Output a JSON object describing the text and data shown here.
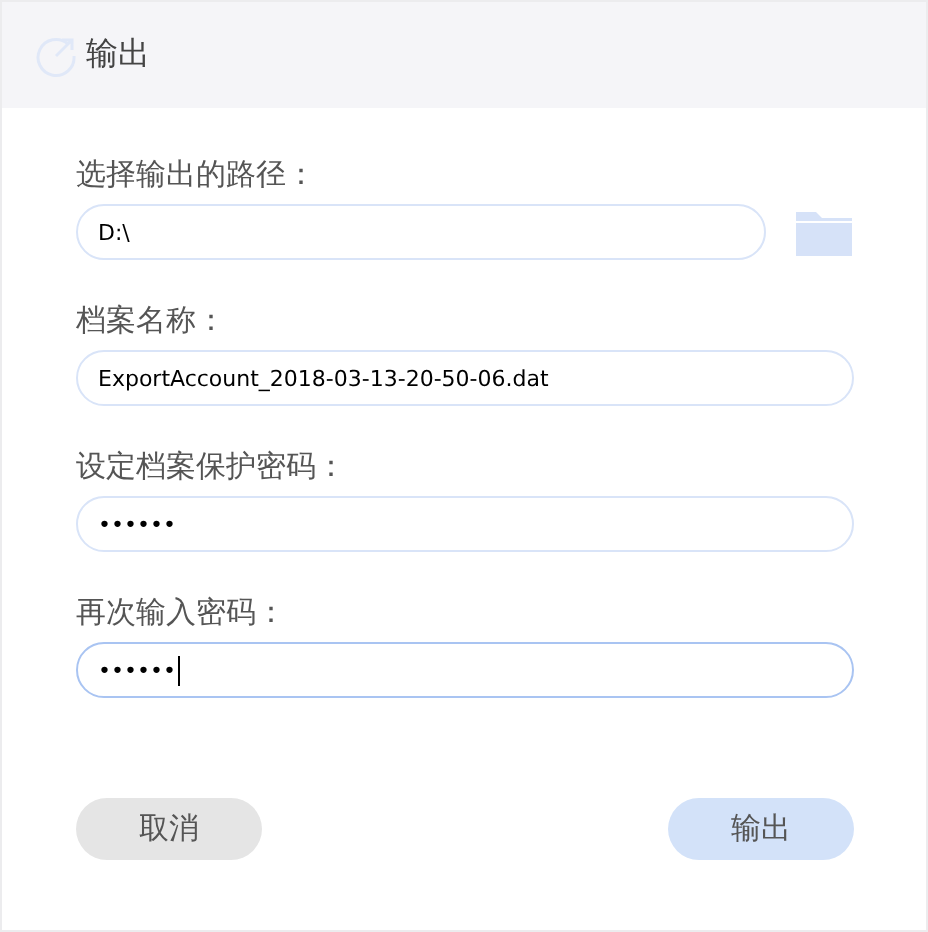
{
  "window": {
    "title": "输出"
  },
  "fields": [
    {
      "kind": "path",
      "label": "选择输出的路径：",
      "value": "D:\\",
      "focused": false
    },
    {
      "kind": "text",
      "label": "档案名称：",
      "value": "ExportAccount_2018-03-13-20-50-06.dat",
      "focused": false
    },
    {
      "kind": "text",
      "label": "设定档案保护密码：",
      "value": "••••••",
      "focused": false
    },
    {
      "kind": "text",
      "label": "再次输入密码：",
      "value": "••••••",
      "focused": true
    }
  ],
  "buttons": [
    {
      "kind": "secondary",
      "label": "取消"
    },
    {
      "kind": "primary",
      "label": "输出"
    }
  ]
}
